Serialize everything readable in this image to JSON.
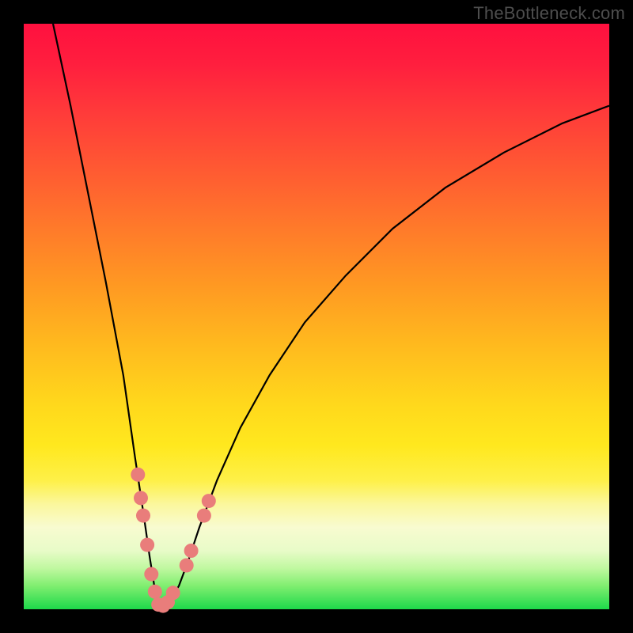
{
  "watermark": "TheBottleneck.com",
  "colors": {
    "frame": "#000000",
    "curve": "#000000",
    "marker_fill": "#e97d7b",
    "marker_stroke": "#c55a58"
  },
  "chart_data": {
    "type": "line",
    "title": "",
    "xlabel": "",
    "ylabel": "",
    "xlim": [
      0,
      100
    ],
    "ylim": [
      0,
      100
    ],
    "note": "V-shaped bottleneck curve; y≈0 at minimum near x≈23, steep on left, shallower asymptotic rise on right. Axes unlabeled; values are read off relative position (0–100%).",
    "series": [
      {
        "name": "curve",
        "x": [
          5,
          8,
          11,
          14,
          17,
          19,
          20.5,
          21.5,
          22.3,
          23,
          24,
          25,
          26.5,
          28,
          30,
          33,
          37,
          42,
          48,
          55,
          63,
          72,
          82,
          92,
          100
        ],
        "y": [
          100,
          86,
          71,
          56,
          40,
          26,
          16,
          9,
          4,
          0.5,
          0.5,
          1.5,
          4,
          8,
          14,
          22,
          31,
          40,
          49,
          57,
          65,
          72,
          78,
          83,
          86
        ]
      }
    ],
    "markers": {
      "name": "highlight-points",
      "note": "Salmon dots clustered around the trough / lower arms of the V",
      "points": [
        {
          "x": 19.5,
          "y": 23
        },
        {
          "x": 20.0,
          "y": 19
        },
        {
          "x": 20.4,
          "y": 16
        },
        {
          "x": 21.1,
          "y": 11
        },
        {
          "x": 21.8,
          "y": 6
        },
        {
          "x": 22.4,
          "y": 3
        },
        {
          "x": 23.0,
          "y": 0.8
        },
        {
          "x": 23.8,
          "y": 0.6
        },
        {
          "x": 24.6,
          "y": 1.2
        },
        {
          "x": 25.5,
          "y": 2.8
        },
        {
          "x": 27.8,
          "y": 7.5
        },
        {
          "x": 28.6,
          "y": 10
        },
        {
          "x": 30.8,
          "y": 16
        },
        {
          "x": 31.6,
          "y": 18.5
        }
      ]
    }
  }
}
